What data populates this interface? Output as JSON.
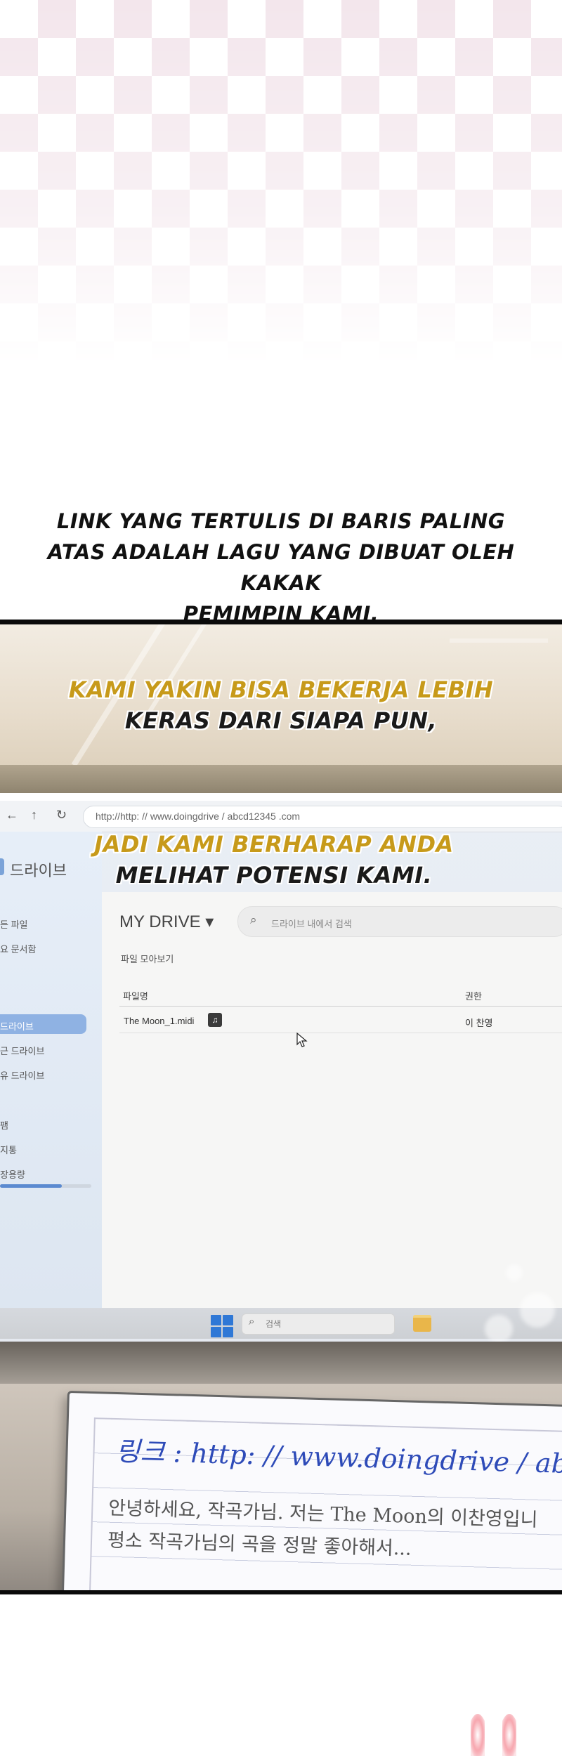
{
  "caption_top": {
    "lines": [
      "LINK YANG TERTULIS DI BARIS PALING",
      "ATAS ADALAH LAGU YANG DIBUAT OLEH KAKAK",
      "PEMIMPIN KAMI."
    ]
  },
  "panel1": {
    "line1": "KAMI YAKIN BISA BEKERJA LEBIH",
    "line2": "KERAS DARI SIAPA PUN,"
  },
  "panel2_caption": {
    "line1": "JADI KAMI BERHARAP ANDA",
    "line2": "MELIHAT POTENSI KAMI."
  },
  "browser": {
    "back_glyph": "←",
    "up_glyph": "↑",
    "reload_glyph": "↻",
    "url": "http://http: // www.doingdrive / abcd12345 .com"
  },
  "drive": {
    "title": "드라이브",
    "sidebar": [
      "든 파일",
      "요 문서함",
      "드라이브",
      "근 드라이브",
      "유 드라이브",
      "팸",
      "지통",
      "장용량"
    ],
    "heading": "MY DRIVE ▾",
    "search_placeholder": "드라이브 내에서 검색",
    "view_all": "파일 모아보기",
    "columns": {
      "name": "파일명",
      "permission": "권한"
    },
    "file": {
      "name": "The Moon_1.midi",
      "icon": "♫",
      "owner": "이 찬영"
    },
    "storage_fraction": 0.68
  },
  "taskbar": {
    "search_placeholder": "검색"
  },
  "note": {
    "link_text": "링크 : http: // www.doingdrive / abc",
    "line1": "안녕하세요, 작곡가님. 저는 The Moon의 이찬영입니",
    "line2": "평소 작곡가님의 곡을 정말 좋아해서..."
  },
  "colors": {
    "gold_text": "#c79a1a",
    "drive_blue": "#2f78d6",
    "link_ink": "#2e4bb8"
  }
}
